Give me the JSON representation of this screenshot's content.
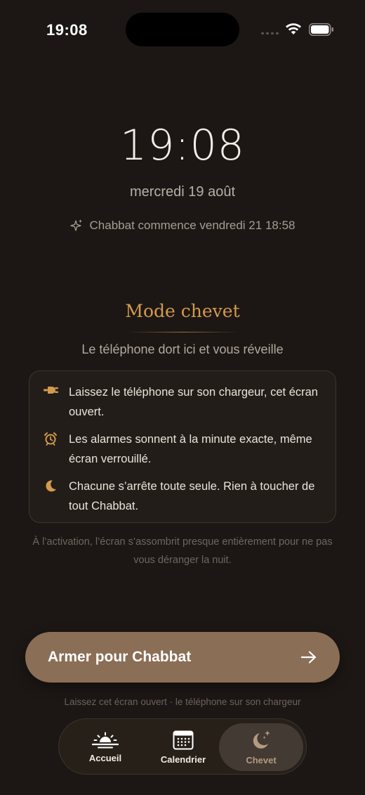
{
  "status": {
    "time": "19:08"
  },
  "lock": {
    "time": "19:08",
    "date": "mercredi 19 août",
    "shabbat_start": "Chabbat commence vendredi 21 18:58"
  },
  "mode": {
    "title": "Mode chevet",
    "subtitle": "Le téléphone dort ici et vous réveille",
    "rules": [
      {
        "icon": "plug-icon",
        "text": "Laissez le téléphone sur son chargeur, cet écran ouvert."
      },
      {
        "icon": "alarm-clock-icon",
        "text": "Les alarmes sonnent à la minute exacte, même écran verrouillé."
      },
      {
        "icon": "moon-icon",
        "text": "Chacune s’arrête toute seule. Rien à toucher de tout Chabbat."
      }
    ],
    "note": "À l’activation, l’écran s’assombrit presque entièrement pour ne pas vous déranger la nuit."
  },
  "action": {
    "label": "Armer pour Chabbat",
    "icon": "arrow-right-icon",
    "hint": "Laissez cet écran ouvert · le téléphone sur son chargeur"
  },
  "tabs": [
    {
      "label": "Accueil",
      "icon": "sunrise-icon",
      "active": false
    },
    {
      "label": "Calendrier",
      "icon": "calendar-icon",
      "active": false
    },
    {
      "label": "Chevet",
      "icon": "moon-stars-icon",
      "active": true
    }
  ],
  "colors": {
    "background": "#1c1714",
    "accent": "#d39a4e",
    "button": "#8b6e56"
  }
}
